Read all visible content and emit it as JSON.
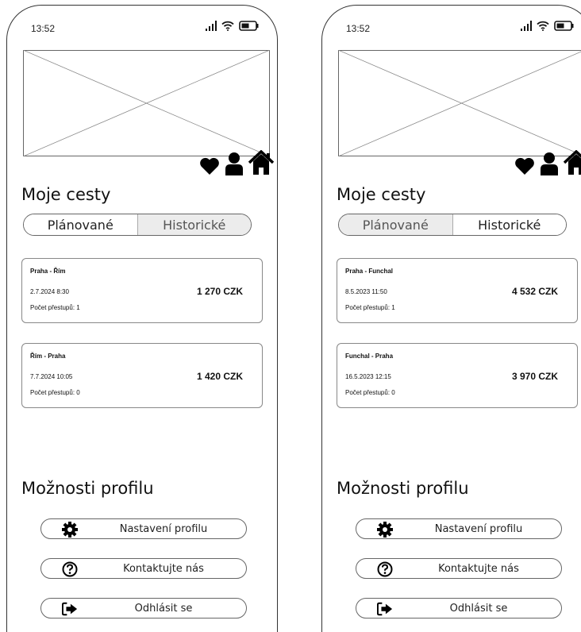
{
  "screens": [
    {
      "status": {
        "time": "13:52"
      },
      "hero": {
        "alt": "image placeholder"
      },
      "actions": {
        "icons": [
          "heart-icon",
          "user-icon",
          "home-icon"
        ]
      },
      "trips_title": "Moje cesty",
      "tabs": [
        {
          "label": "Plánované",
          "active": true
        },
        {
          "label": "Historické",
          "active": false
        }
      ],
      "trips": [
        {
          "route": "Praha - Řím",
          "date": "2.7.2024 8:30",
          "price": "1 270 CZK",
          "transfers": "Počet přestupů: 1"
        },
        {
          "route": "Řím - Praha",
          "date": "7.7.2024 10:05",
          "price": "1 420 CZK",
          "transfers": "Počet přestupů: 0"
        }
      ],
      "profile_title": "Možnosti profilu",
      "profile_buttons": [
        {
          "label": "Nastavení profilu",
          "icon": "gear-icon"
        },
        {
          "label": "Kontaktujte nás",
          "icon": "question-circle-icon"
        },
        {
          "label": "Odhlásit se",
          "icon": "sign-out-icon"
        }
      ]
    },
    {
      "status": {
        "time": "13:52"
      },
      "hero": {
        "alt": "image placeholder"
      },
      "actions": {
        "icons": [
          "heart-icon",
          "user-icon",
          "home-icon"
        ]
      },
      "trips_title": "Moje cesty",
      "tabs": [
        {
          "label": "Plánované",
          "active": false
        },
        {
          "label": "Historické",
          "active": true
        }
      ],
      "trips": [
        {
          "route": "Praha - Funchal",
          "date": "8.5.2023 11:50",
          "price": "4 532 CZK",
          "transfers": "Počet přestupů: 1"
        },
        {
          "route": "Funchal - Praha",
          "date": "16.5.2023 12:15",
          "price": "3 970 CZK",
          "transfers": "Počet přestupů: 0"
        }
      ],
      "profile_title": "Možnosti profilu",
      "profile_buttons": [
        {
          "label": "Nastavení profilu",
          "icon": "gear-icon"
        },
        {
          "label": "Kontaktujte nás",
          "icon": "question-circle-icon"
        },
        {
          "label": "Odhlásit se",
          "icon": "sign-out-icon"
        }
      ]
    }
  ]
}
